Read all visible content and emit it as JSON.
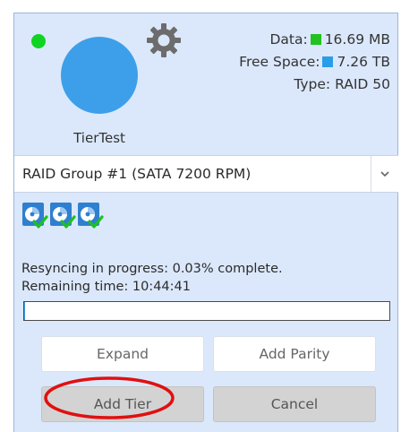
{
  "tier": {
    "name": "TierTest",
    "status_color": "#11d422",
    "avatar_color": "#3d9fe9",
    "settings_icon": "gear-icon"
  },
  "stats": {
    "data_label": "Data:",
    "data_value": "16.69 MB",
    "data_color": "#22c11f",
    "free_label": "Free Space:",
    "free_value": "7.26 TB",
    "free_color": "#2a9de8",
    "type_label": "Type:",
    "type_value": "RAID 50"
  },
  "raid_group": {
    "selected": "RAID Group #1 (SATA 7200 RPM)",
    "dropdown_icon": "chevron-down-icon"
  },
  "disks": [
    {
      "icon": "disk-ok-icon",
      "status": "ok"
    },
    {
      "icon": "disk-ok-icon",
      "status": "ok"
    },
    {
      "icon": "disk-ok-icon",
      "status": "ok"
    }
  ],
  "progress": {
    "line1": "Resyncing in progress: 0.03% complete.",
    "line2": "Remaining time: 10:44:41",
    "percent": 0.03
  },
  "buttons": {
    "expand": "Expand",
    "add_parity": "Add Parity",
    "add_tier": "Add Tier",
    "cancel": "Cancel"
  },
  "annotation_color": "#e01010"
}
